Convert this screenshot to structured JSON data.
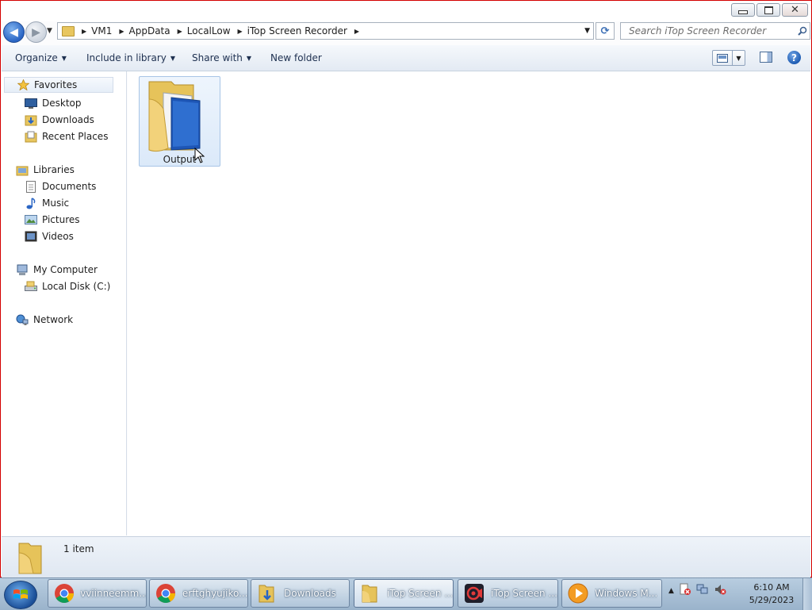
{
  "window": {
    "caption": {
      "minimize": "minimize",
      "maximize": "restore",
      "close": "close"
    }
  },
  "address": {
    "breadcrumbs": [
      "VM1",
      "AppData",
      "LocalLow",
      "iTop Screen Recorder"
    ],
    "search_placeholder": "Search iTop Screen Recorder"
  },
  "commands": {
    "organize": "Organize",
    "include_in_library": "Include in library",
    "share_with": "Share with",
    "new_folder": "New folder"
  },
  "navpane": {
    "favorites": {
      "label": "Favorites",
      "items": [
        "Desktop",
        "Downloads",
        "Recent Places"
      ]
    },
    "libraries": {
      "label": "Libraries",
      "items": [
        "Documents",
        "Music",
        "Pictures",
        "Videos"
      ]
    },
    "computer": {
      "label": "My Computer",
      "items": [
        "Local Disk (C:)"
      ]
    },
    "network": {
      "label": "Network"
    }
  },
  "content": {
    "items": [
      {
        "name": "Output"
      }
    ]
  },
  "details": {
    "count": "1 item"
  },
  "taskbar": {
    "buttons": [
      {
        "label": "vviinneemm...",
        "icon": "chrome-icon"
      },
      {
        "label": "erftghyujiko...",
        "icon": "chrome-icon"
      },
      {
        "label": "Downloads",
        "icon": "folder-download-icon"
      },
      {
        "label": "iTop Screen ...",
        "icon": "folder-icon"
      },
      {
        "label": "iTop Screen ...",
        "icon": "itop-recorder-icon"
      },
      {
        "label": "Windows M...",
        "icon": "media-player-icon"
      }
    ],
    "clock": {
      "time": "6:10 AM",
      "date": "5/29/2023"
    }
  }
}
